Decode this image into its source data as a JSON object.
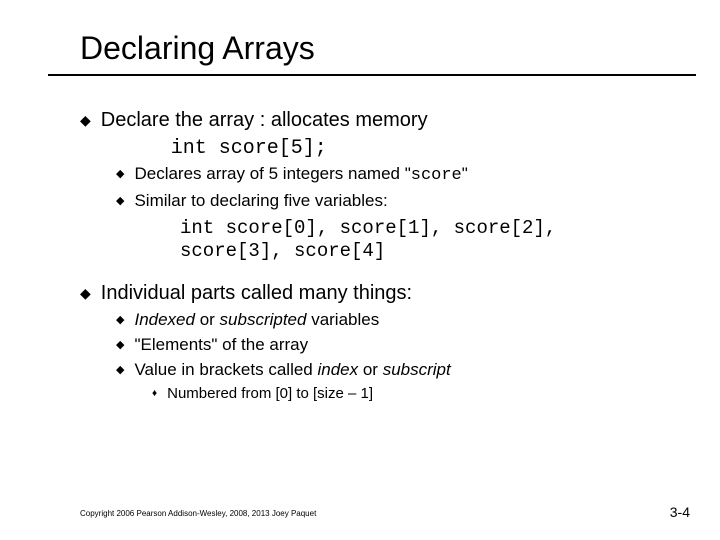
{
  "title": "Declaring Arrays",
  "p1": {
    "text_a": "Declare the array : allocates memory",
    "code": "int score[5];",
    "sub1_a": "Declares array of 5 integers named \"",
    "sub1_code": "score",
    "sub1_b": "\"",
    "sub2": "Similar to declaring five variables:",
    "code_block_l1": "int score[0], score[1], score[2],",
    "code_block_l2": "score[3], score[4]"
  },
  "p2": {
    "text": "Individual parts called many things:",
    "sub1_a": "Indexed",
    "sub1_b": " or ",
    "sub1_c": "subscripted",
    "sub1_d": " variables",
    "sub2": "\"Elements\" of the array",
    "sub3_a": "Value in brackets called ",
    "sub3_b": "index",
    "sub3_c": " or ",
    "sub3_d": "subscript",
    "subsub": "Numbered from [0] to [size – 1]"
  },
  "footer": "Copyright  2006 Pearson Addison-Wesley, 2008, 2013 Joey Paquet",
  "pagenum": "3-4"
}
